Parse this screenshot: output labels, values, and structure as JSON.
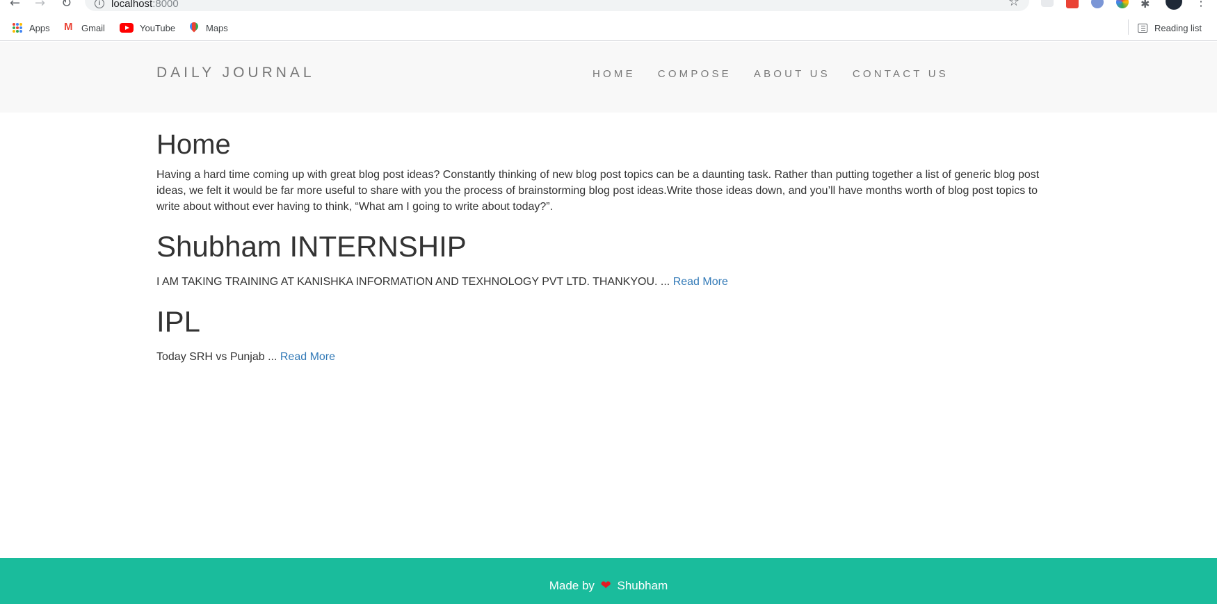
{
  "browser": {
    "url_host": "localhost",
    "url_port": ":8000",
    "bookmarks": [
      {
        "label": "Apps",
        "icon": "apps-grid-icon"
      },
      {
        "label": "Gmail",
        "icon": "gmail-icon"
      },
      {
        "label": "YouTube",
        "icon": "youtube-icon"
      },
      {
        "label": "Maps",
        "icon": "maps-icon"
      }
    ],
    "reading_list": "Reading list"
  },
  "site": {
    "brand": "DAILY JOURNAL",
    "nav": [
      "HOME",
      "COMPOSE",
      "ABOUT US",
      "CONTACT US"
    ]
  },
  "main": {
    "title": "Home",
    "intro": "Having a hard time coming up with great blog post ideas? Constantly thinking of new blog post topics can be a daunting task. Rather than putting together a list of generic blog post ideas, we felt it would be far more useful to share with you the process of brainstorming blog post ideas.Write those ideas down, and you’ll have months worth of blog post topics to write about without ever having to think, “What am I going to write about today?”.",
    "posts": [
      {
        "title": "Shubham INTERNSHIP",
        "excerpt": "I AM TAKING TRAINING AT KANISHKA INFORMATION AND TEXHNOLOGY PVT LTD. THANKYOU. ...",
        "link": "Read More"
      },
      {
        "title": "IPL",
        "excerpt": "Today SRH vs Punjab ...",
        "link": "Read More"
      }
    ]
  },
  "footer": {
    "made_by": "Made by",
    "author": "Shubham"
  },
  "colors": {
    "footer_bg": "#1abc9c",
    "link": "#337ab7",
    "header_bg": "#f8f8f8",
    "heart": "#e31b23"
  }
}
